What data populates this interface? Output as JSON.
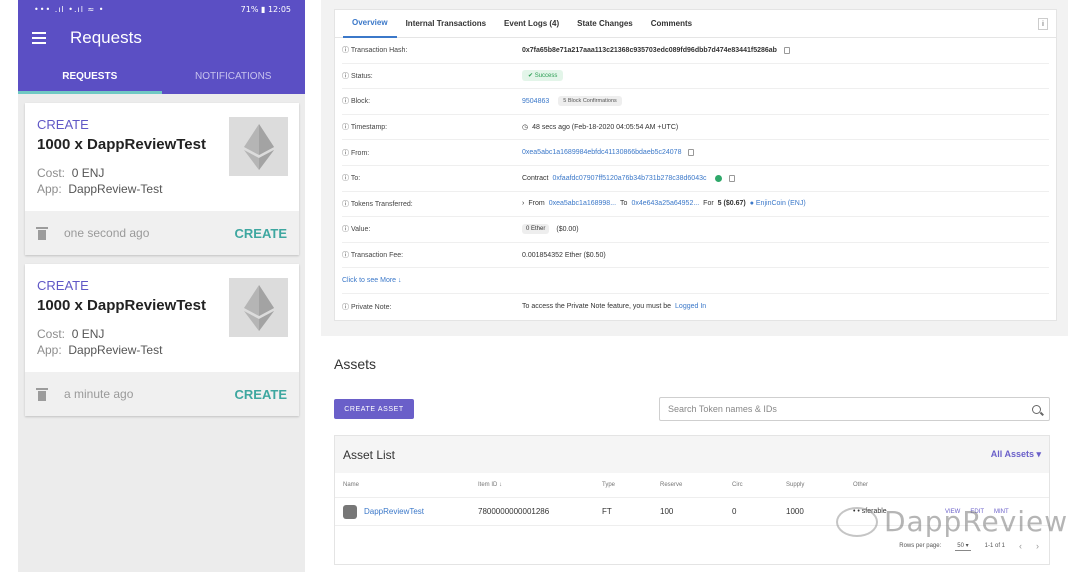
{
  "phone": {
    "status": {
      "left": "••• .ıl •.ıl ≈ •",
      "battery": "71%",
      "time": "12:05"
    },
    "title": "Requests",
    "tabs": [
      "REQUESTS",
      "NOTIFICATIONS"
    ],
    "cards": [
      {
        "kind": "CREATE",
        "name": "1000 x DappReviewTest",
        "cost_label": "Cost:",
        "cost": "0 ENJ",
        "app_label": "App:",
        "app": "DappReview-Test",
        "time": "one second ago",
        "action": "CREATE"
      },
      {
        "kind": "CREATE",
        "name": "1000 x DappReviewTest",
        "cost_label": "Cost:",
        "cost": "0 ENJ",
        "app_label": "App:",
        "app": "DappReview-Test",
        "time": "a minute ago",
        "action": "CREATE"
      }
    ]
  },
  "explorer": {
    "tabs": [
      "Overview",
      "Internal Transactions",
      "Event Logs (4)",
      "State Changes",
      "Comments"
    ],
    "rows": {
      "hash": {
        "k": "Transaction Hash:",
        "v": "0x7fa65b8e71a217aaa113c21368c935703edc089fd96dbb7d474e83441f5286ab"
      },
      "status": {
        "k": "Status:",
        "v": "Success"
      },
      "block": {
        "k": "Block:",
        "v": "9504863",
        "conf": "5 Block Confirmations"
      },
      "timestamp": {
        "k": "Timestamp:",
        "v": "48 secs ago (Feb-18-2020 04:05:54 AM +UTC)"
      },
      "from": {
        "k": "From:",
        "v": "0xea5abc1a1689984ebfdc41130866bdaeb5c24078"
      },
      "to": {
        "k": "To:",
        "prefix": "Contract",
        "v": "0xfaafdc07907ff5120a76b34b731b278c38d6043c"
      },
      "tokens": {
        "k": "Tokens Transferred:",
        "from_label": "From",
        "from": "0xea5abc1a168998...",
        "to_label": "To",
        "to": "0x4e643a25a64952...",
        "for_label": "For",
        "amount": "5 ($0.67)",
        "token": "EnjinCoin (ENJ)"
      },
      "value": {
        "k": "Value:",
        "v": "0 Ether",
        "usd": "($0.00)"
      },
      "fee": {
        "k": "Transaction Fee:",
        "v": "0.001854352 Ether ($0.50)"
      },
      "more": "Click to see More",
      "note": {
        "k": "Private Note:",
        "v": "To access the Private Note feature, you must be",
        "link": "Logged In"
      }
    }
  },
  "assets": {
    "title": "Assets",
    "create_label": "CREATE ASSET",
    "search_placeholder": "Search Token names & IDs",
    "list_title": "Asset List",
    "filter": "All Assets ▾",
    "columns": [
      "Name",
      "Item ID ↓",
      "Type",
      "Reserve",
      "Circ",
      "Supply",
      "Other"
    ],
    "row": {
      "name": "DappReviewTest",
      "id": "7800000000001286",
      "type": "FT",
      "reserve": "100",
      "circ": "0",
      "supply": "1000",
      "other": "• • sferable",
      "view": "VIEW",
      "edit": "EDIT",
      "mint": "MINT"
    },
    "pager": {
      "rows_label": "Rows per page:",
      "rows": "50",
      "range": "1-1 of 1",
      "prev": "‹",
      "next": "›"
    }
  },
  "watermark": "DappReview"
}
